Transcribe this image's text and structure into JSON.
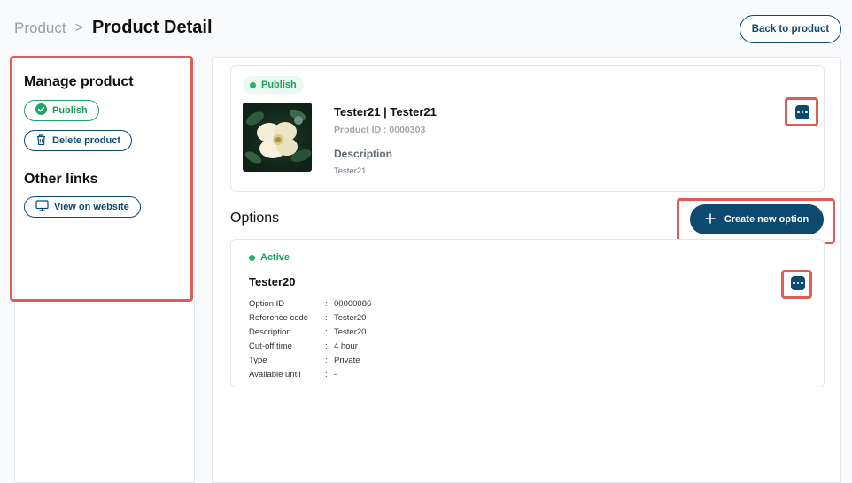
{
  "breadcrumb": {
    "root": "Product",
    "separator": ">",
    "current": "Product Detail"
  },
  "header": {
    "back_label": "Back to product"
  },
  "sidebar": {
    "manage_title": "Manage product",
    "publish_label": "Publish",
    "delete_label": "Delete product",
    "links_title": "Other links",
    "view_website_label": "View on website"
  },
  "product": {
    "status": "Publish",
    "name": "Tester21 | Tester21",
    "id_text": "Product ID : 0000303",
    "description_label": "Description",
    "description_value": "Tester21"
  },
  "options": {
    "title": "Options",
    "create_label": "Create new option",
    "items": [
      {
        "status": "Active",
        "name": "Tester20",
        "fields": [
          {
            "key": "Option ID",
            "value": "00000086"
          },
          {
            "key": "Reference code",
            "value": "Tester20"
          },
          {
            "key": "Description",
            "value": "Tester20"
          },
          {
            "key": "Cut-off time",
            "value": "4 hour"
          },
          {
            "key": "Type",
            "value": "Private"
          },
          {
            "key": "Available until",
            "value": "-"
          }
        ]
      }
    ]
  },
  "colors": {
    "primary": "#0d4a70",
    "success": "#20a565",
    "highlight": "#e15b58"
  },
  "icons": {
    "publish": "check-circle-icon",
    "delete": "trash-icon",
    "view": "monitor-icon",
    "more": "more-dots-icon",
    "create": "plus-icon"
  }
}
